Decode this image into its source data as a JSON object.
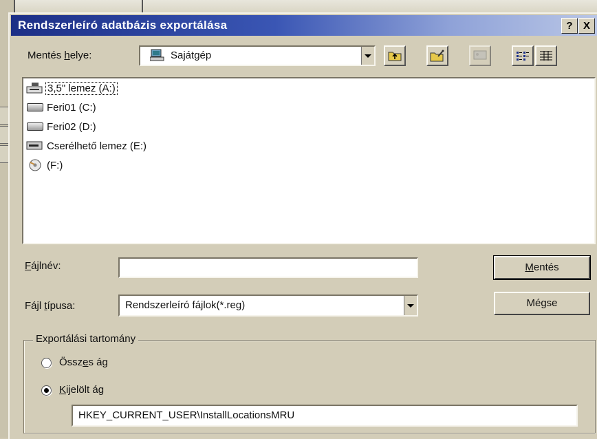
{
  "window": {
    "title": "Rendszerleíró adatbázis exportálása",
    "help_label": "?",
    "close_label": "X",
    "title_color_start": "#1c2f86",
    "title_color_end": "#b9c6e6"
  },
  "save_in": {
    "label_pre": "Mentés ",
    "label_key": "h",
    "label_post": "elye:",
    "value": "Sajátgép",
    "icon": "my-computer-icon"
  },
  "toolbar": {
    "up_icon": "up-folder-icon",
    "new_folder_icon": "new-folder-icon",
    "desktop_icon": "desktop-icon",
    "list_view_icon": "list-view-icon",
    "details_view_icon": "details-view-icon"
  },
  "files": [
    {
      "label": "3,5\" lemez (A:)",
      "icon": "floppy-drive-icon",
      "selected": true
    },
    {
      "label": "Feri01 (C:)",
      "icon": "hard-drive-icon",
      "selected": false
    },
    {
      "label": "Feri02 (D:)",
      "icon": "hard-drive-icon",
      "selected": false
    },
    {
      "label": "Cserélhető lemez (E:)",
      "icon": "removable-drive-icon",
      "selected": false
    },
    {
      "label": "(F:)",
      "icon": "cd-drive-icon",
      "selected": false
    }
  ],
  "filename": {
    "label_key": "F",
    "label_post": "ájlnév:",
    "value": ""
  },
  "filetype": {
    "label_pre": "Fájl ",
    "label_key": "t",
    "label_post": "ípusa:",
    "value": "Rendszerleíró fájlok(*.reg)"
  },
  "buttons": {
    "save_key": "M",
    "save_post": "entés",
    "cancel": "Mégse"
  },
  "export_range": {
    "title": "Exportálási tartomány",
    "all_pre": "Össz",
    "all_key": "e",
    "all_post": "s ág",
    "all_checked": false,
    "selected_key": "K",
    "selected_post": "ijelölt ág",
    "selected_checked": true,
    "branch_value": "HKEY_CURRENT_USER\\InstallLocationsMRU"
  }
}
